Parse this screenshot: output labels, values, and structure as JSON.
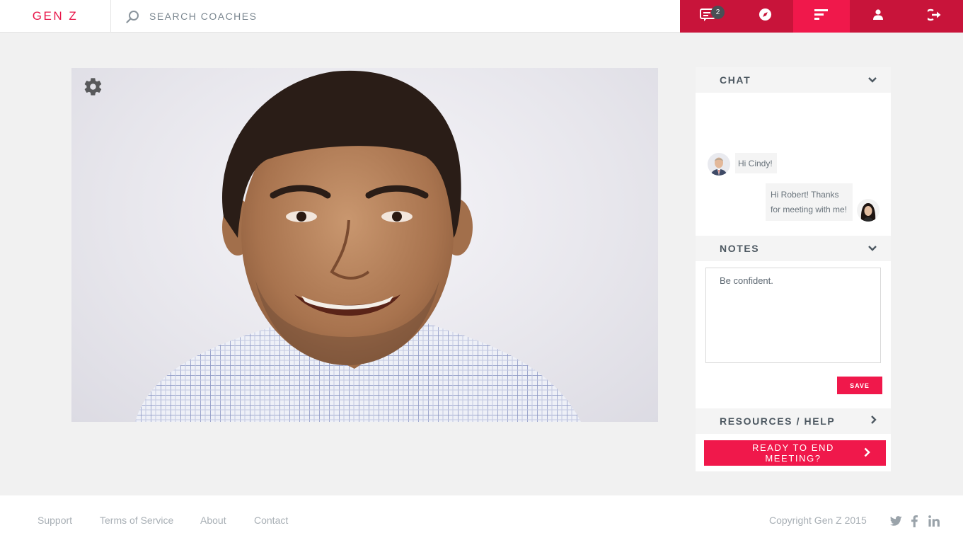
{
  "app": {
    "logo": "GEN Z"
  },
  "search": {
    "placeholder": "SEARCH COACHES"
  },
  "nav": {
    "messages_badge": "2",
    "items": [
      "messages-icon",
      "compass-icon",
      "menu-icon",
      "user-icon",
      "logout-icon"
    ],
    "active": "menu-icon"
  },
  "video": {
    "settings_icon": "gear-icon"
  },
  "chat": {
    "title": "CHAT",
    "messages": [
      {
        "sender": "coach",
        "text": "Hi Cindy!"
      },
      {
        "sender": "me",
        "text": "Hi Robert! Thanks for meeting with me!"
      }
    ]
  },
  "notes": {
    "title": "NOTES",
    "value": "Be confident.",
    "save_label": "SAVE"
  },
  "resources": {
    "title": "RESOURCES / HELP"
  },
  "end_meeting": {
    "label": "READY TO END MEETING?"
  },
  "footer": {
    "links": [
      "Support",
      "Terms of Service",
      "About",
      "Contact"
    ],
    "copyright": "Copyright Gen Z 2015",
    "social": [
      "twitter-icon",
      "facebook-icon",
      "linkedin-icon"
    ]
  },
  "colors": {
    "accent": "#f0184b",
    "nav_bg": "#c8143a",
    "logo": "#e8174a"
  }
}
